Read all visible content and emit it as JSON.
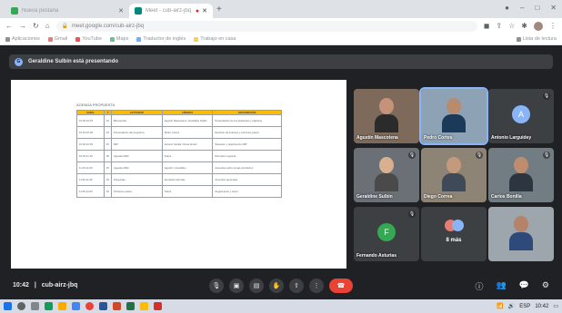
{
  "browser": {
    "tabs": [
      {
        "label": "Nueva pestaña",
        "active": false,
        "color": "#34a853"
      },
      {
        "label": "Meet - cub-airz-jbq",
        "active": true,
        "recording": true,
        "color": "#00897b"
      }
    ],
    "url": "meet.google.com/cub-airz-jbq",
    "bookmarks": [
      {
        "label": "Aplicaciones",
        "color": "#5f6368"
      },
      {
        "label": "Gmail",
        "color": "#ea4335"
      },
      {
        "label": "YouTube",
        "color": "#ff0000"
      },
      {
        "label": "Maps",
        "color": "#34a853"
      },
      {
        "label": "Traductor de inglés",
        "color": "#4285f4"
      },
      {
        "label": "Trabajo en casa",
        "color": "#fbbc04"
      }
    ],
    "reading_list": "Lista de lectura"
  },
  "meet": {
    "presenter_banner": "Geraldine Sulbin está presentando",
    "presenter_initial": "G",
    "time": "10:42",
    "meeting_code": "cub-airz-jbq",
    "controls": [
      "mic-icon",
      "camera-icon",
      "captions-icon",
      "raise-hand-icon",
      "present-icon",
      "more-icon",
      "hang-up-icon"
    ],
    "right_controls": [
      "info-icon",
      "people-icon",
      "chat-icon",
      "activities-icon"
    ]
  },
  "slide": {
    "title": "AGENDA PROPUESTA",
    "headers": [
      "HORA",
      "T",
      "ACTIVIDAD",
      "LÍDERES",
      "DESCRIPCIÓN"
    ],
    "rows": [
      [
        "10:00-10:15",
        "15",
        "Bienvenida",
        "Agustín Mascotena / Geraldine Sulbin",
        "Presentación de los asistentes y objetivos"
      ],
      [
        "10:15-10:30",
        "15",
        "Presentación del programa",
        "Pedro Cortes",
        "Revisión de avances y próximos pasos"
      ],
      [
        "10:30-10:45",
        "15",
        "MIP",
        "Antonio Sevilla / Rosa Arnaiz",
        "Situación y objetivos de MIP"
      ],
      [
        "10:45-11:15",
        "30",
        "Agenda 2022",
        "Todos",
        "Discusión regional"
      ],
      [
        "11:15-11:30",
        "15",
        "Agenda 2022",
        "Agustín / Geraldine",
        "Acuerdos sobre temas prioritarios"
      ],
      [
        "11:30-11:45",
        "15",
        "Preguntas",
        "Fernando Asturias",
        "Acuerdos generales"
      ],
      [
        "11:45-12:00",
        "15",
        "Próximos pasos",
        "Todos",
        "Seguimiento y cierre"
      ]
    ]
  },
  "participants": [
    {
      "name": "Agustín Mascotena",
      "type": "video",
      "bg": "#7d6a5b"
    },
    {
      "name": "Pedro Cortes",
      "type": "video",
      "bg": "#8da2b5",
      "speaking": true
    },
    {
      "name": "Antonio Larguidey",
      "type": "avatar",
      "initial": "A",
      "avatar_color": "#8ab4f8",
      "bg": "#3c4043"
    },
    {
      "name": "Geraldine Sulbin",
      "type": "video",
      "bg": "#6b7077"
    },
    {
      "name": "Diego Correa",
      "type": "video",
      "bg": "#8e8476"
    },
    {
      "name": "Carlos Bonilla",
      "type": "video",
      "bg": "#717d83"
    },
    {
      "name": "Fernando Asturias",
      "type": "avatar",
      "initial": "F",
      "avatar_color": "#34a853",
      "bg": "#3c4043"
    },
    {
      "name": "8 más",
      "type": "more",
      "bg": "#3c4043"
    },
    {
      "name": "",
      "type": "video",
      "bg": "#9da6ad"
    }
  ],
  "taskbar": {
    "time": "10:42",
    "lang": "ESP"
  }
}
